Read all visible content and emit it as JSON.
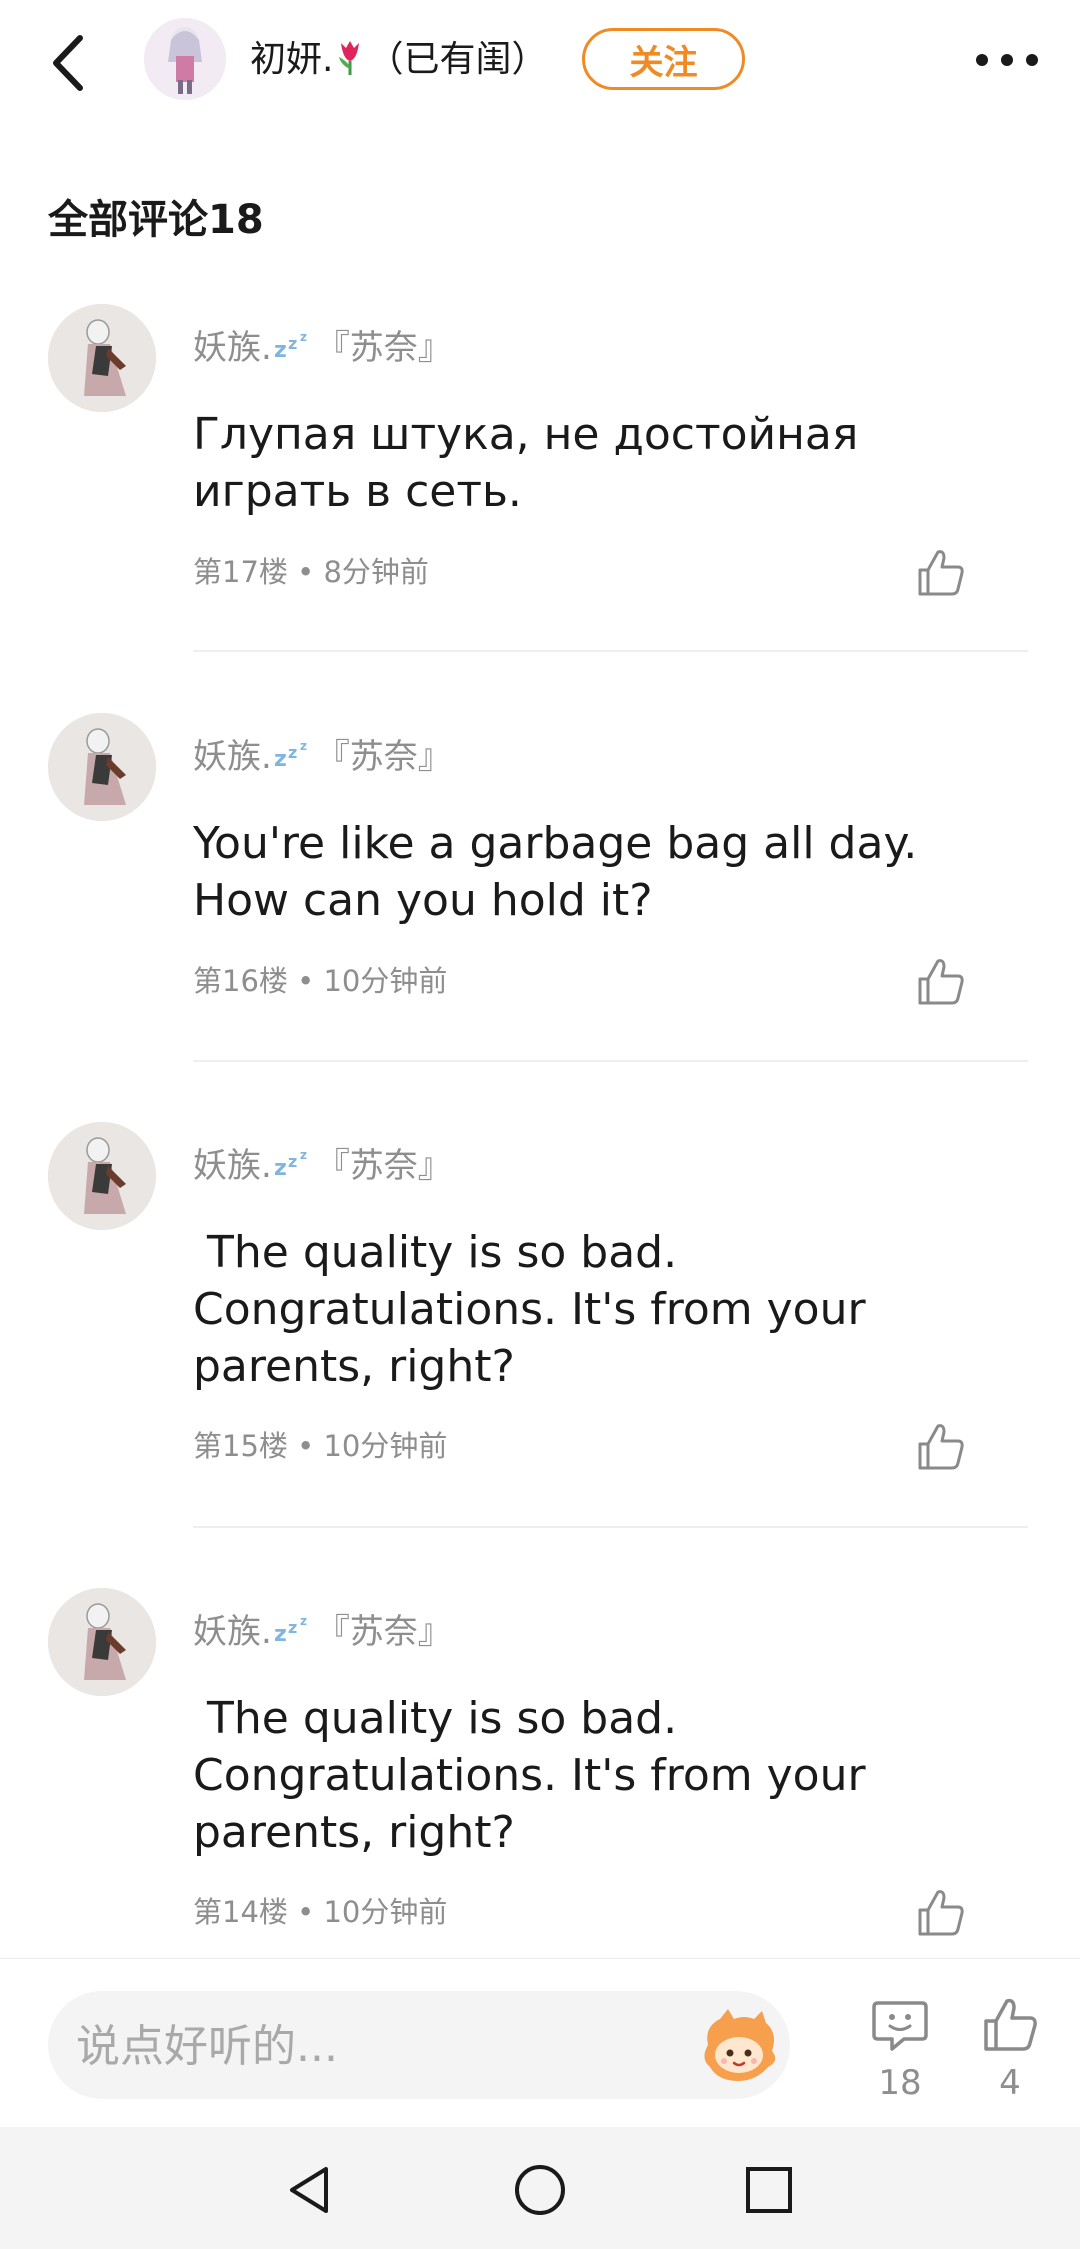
{
  "header": {
    "back_icon": "chevron-left-icon",
    "author_name": "初妍.",
    "author_suffix": "（已有闺）",
    "follow_label": "关注",
    "more_icon": "more-dots-icon"
  },
  "section_title": "全部评论18",
  "comments": [
    {
      "user": "妖族.",
      "user_suffix": "『苏奈』",
      "text": "Глупая штука, не достойная\nиграть в сеть.",
      "floor": "第17楼",
      "time": "8分钟前"
    },
    {
      "user": "妖族.",
      "user_suffix": "『苏奈』",
      "text": "You're like a garbage bag all day.\nHow can you hold it?",
      "floor": "第16楼",
      "time": "10分钟前"
    },
    {
      "user": "妖族.",
      "user_suffix": "『苏奈』",
      "text": " The quality is so bad.\nCongratulations. It's from your\nparents, right?",
      "floor": "第15楼",
      "time": "10分钟前"
    },
    {
      "user": "妖族.",
      "user_suffix": "『苏奈』",
      "text": " The quality is so bad.\nCongratulations. It's from your\nparents, right?",
      "floor": "第14楼",
      "time": "10分钟前"
    }
  ],
  "meta_separator": "•",
  "input_bar": {
    "placeholder": "说点好听的...",
    "comment_count": "18",
    "like_count": "4"
  },
  "colors": {
    "accent": "#f08a24",
    "muted_text": "#8e8e8e",
    "divider": "#eeeeee"
  }
}
